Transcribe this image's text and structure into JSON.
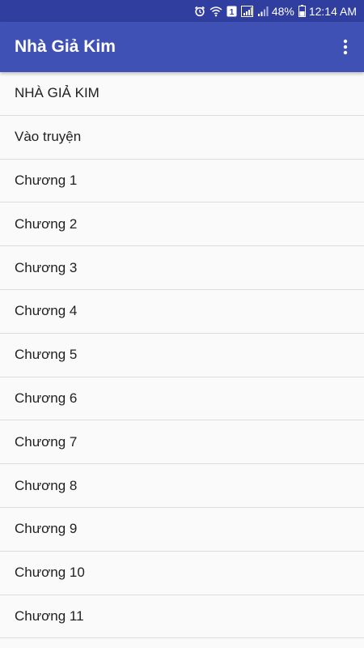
{
  "status_bar": {
    "sim_badge": "1",
    "battery": "48%",
    "time": "12:14 AM",
    "icons": [
      "alarm-icon",
      "wifi-icon",
      "sim-1-icon",
      "signal-icon",
      "signal-icon",
      "battery-icon"
    ]
  },
  "app_bar": {
    "title": "Nhà Giả Kim",
    "menu_icon": "more-vert-icon"
  },
  "list": {
    "items": [
      "NHÀ GIẢ KIM",
      "Vào truyện",
      "Chương 1",
      "Chương 2",
      "Chương 3",
      "Chương 4",
      "Chương 5",
      "Chương 6",
      "Chương 7",
      "Chương 8",
      "Chương 9",
      "Chương 10",
      "Chương 11"
    ]
  },
  "colors": {
    "status_bar": "#303f9f",
    "app_bar": "#3f51b5",
    "background": "#fafafa",
    "divider": "#dcdcdc",
    "text": "#212121"
  }
}
